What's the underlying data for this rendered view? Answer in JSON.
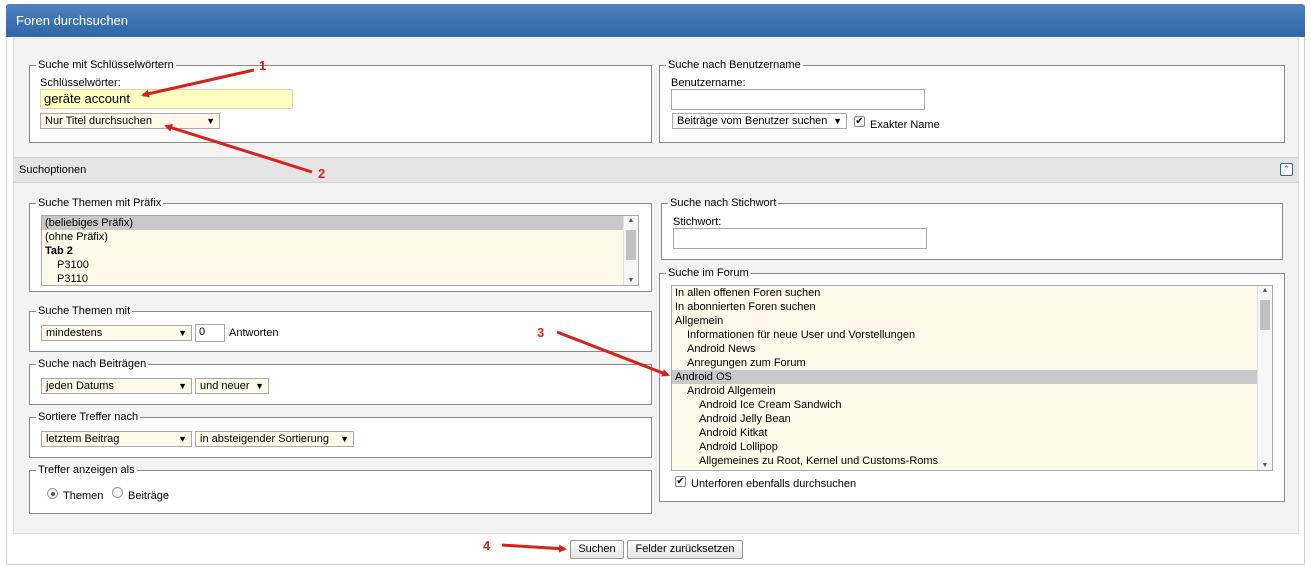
{
  "window": {
    "title": "Foren durchsuchen"
  },
  "keywords": {
    "legend": "Suche mit Schlüsselwörtern",
    "label": "Schlüsselwörter:",
    "value": "geräte account",
    "scope": "Nur Titel durchsuchen"
  },
  "username": {
    "legend": "Suche nach Benutzername",
    "label": "Benutzername:",
    "value": "",
    "mode": "Beiträge vom Benutzer suchen",
    "exact_label": "Exakter Name",
    "exact_checked": true
  },
  "options_bar": {
    "title": "Suchoptionen"
  },
  "prefix": {
    "legend": "Suche Themen mit Präfix",
    "items": [
      "(beliebiges Präfix)",
      "(ohne Präfix)",
      "Tab 2",
      "P3100",
      "P3110"
    ]
  },
  "threads_with": {
    "legend": "Suche Themen mit",
    "mode": "mindestens",
    "count": "0",
    "suffix": "Antworten"
  },
  "posts": {
    "legend": "Suche nach Beiträgen",
    "date": "jeden Datums",
    "direction": "und neuer"
  },
  "sort": {
    "legend": "Sortiere Treffer nach",
    "field": "letztem Beitrag",
    "order": "in absteigender Sortierung"
  },
  "display": {
    "legend": "Treffer anzeigen als",
    "option_threads": "Themen",
    "option_posts": "Beiträge",
    "selected": "Themen"
  },
  "tag": {
    "legend": "Suche nach Stichwort",
    "label": "Stichwort:",
    "value": ""
  },
  "forum": {
    "legend": "Suche im Forum",
    "items": [
      "In allen offenen Foren suchen",
      "In abonnierten Foren suchen",
      "Allgemein",
      "Informationen für neue User und Vorstellungen",
      "Android News",
      "Anregungen zum Forum",
      "Android OS",
      "Android Allgemein",
      "Android Ice Cream Sandwich",
      "Android Jelly Bean",
      "Android Kitkat",
      "Android Lollipop",
      "Allgemeines zu Root, Kernel und Customs-Roms"
    ],
    "subforums_label": "Unterforen ebenfalls durchsuchen",
    "subforums_checked": true
  },
  "buttons": {
    "search": "Suchen",
    "reset": "Felder zurücksetzen"
  },
  "annotations": {
    "n1": "1",
    "n2": "2",
    "n3": "3",
    "n4": "4",
    "color": "#d6221a"
  }
}
